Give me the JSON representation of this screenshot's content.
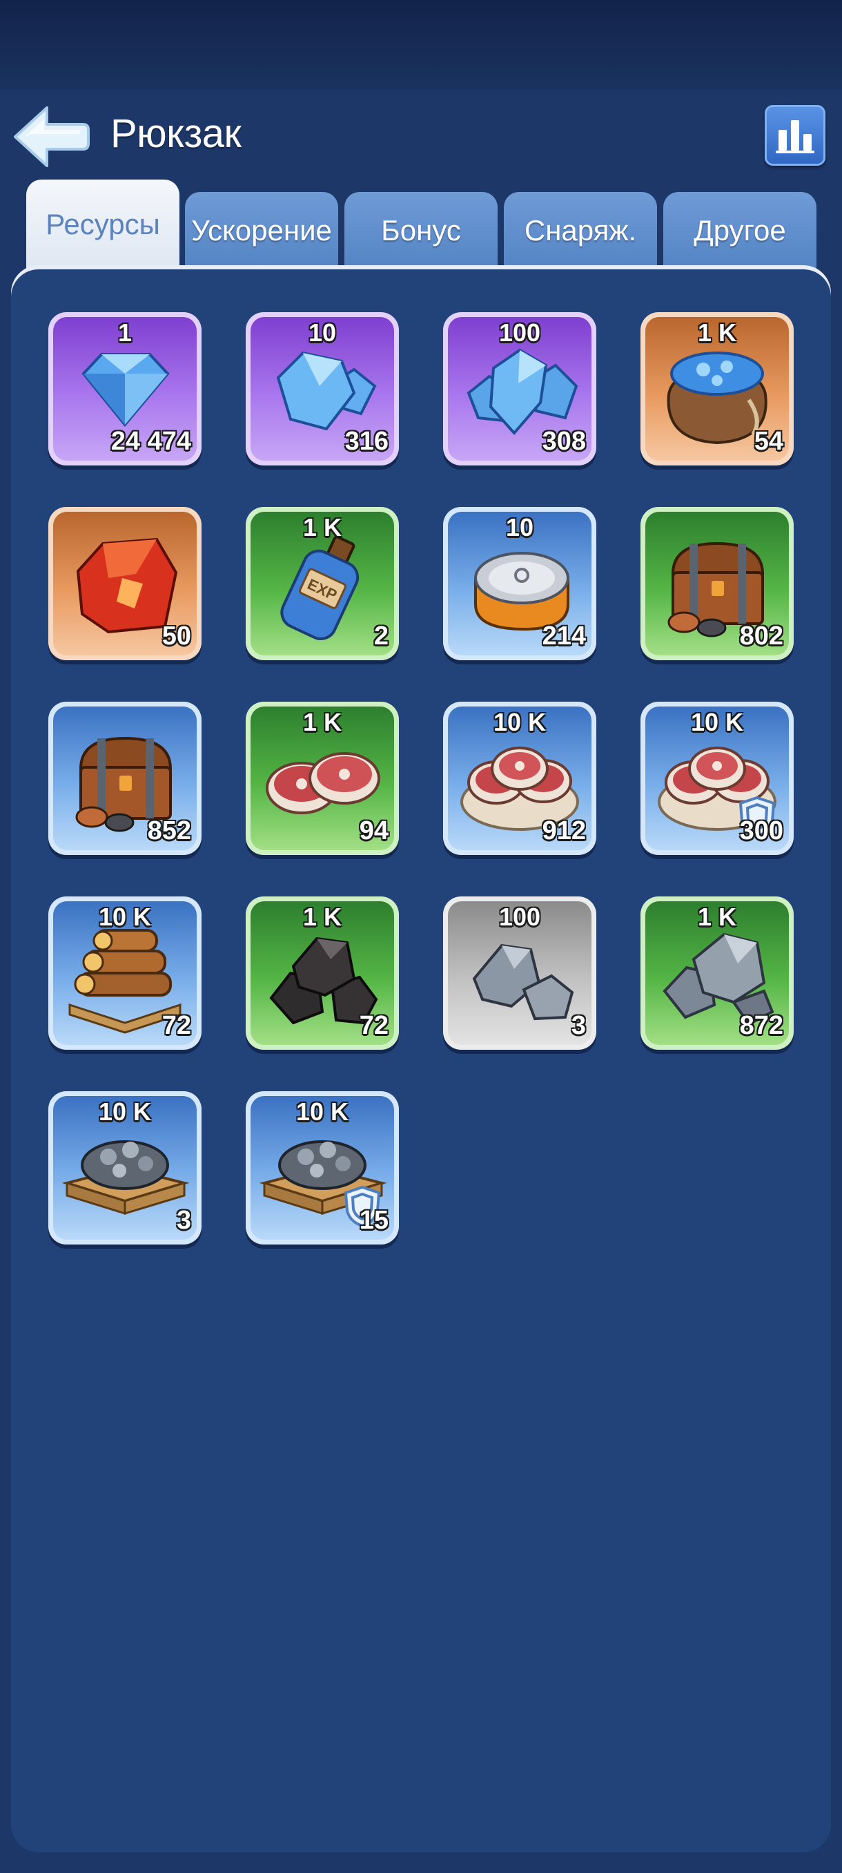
{
  "header": {
    "title": "Рюкзак"
  },
  "tabs": [
    {
      "label": "Ресурсы",
      "active": true
    },
    {
      "label": "Ускорение",
      "active": false
    },
    {
      "label": "Бонус",
      "active": false
    },
    {
      "label": "Снаряж.",
      "active": false
    },
    {
      "label": "Другое",
      "active": false
    }
  ],
  "items": [
    {
      "amount": "1",
      "count": "24 474",
      "rarity": "purple",
      "icon": "gem-icon"
    },
    {
      "amount": "10",
      "count": "316",
      "rarity": "purple",
      "icon": "gems-icon"
    },
    {
      "amount": "100",
      "count": "308",
      "rarity": "purple",
      "icon": "gem-pile-icon"
    },
    {
      "amount": "1 K",
      "count": "54",
      "rarity": "orange",
      "icon": "gem-sack-icon"
    },
    {
      "amount": "",
      "count": "50",
      "rarity": "orange",
      "icon": "red-crystal-icon"
    },
    {
      "amount": "1 K",
      "count": "2",
      "rarity": "green",
      "icon": "exp-potion-icon"
    },
    {
      "amount": "10",
      "count": "214",
      "rarity": "blue",
      "icon": "canned-food-icon"
    },
    {
      "amount": "",
      "count": "802",
      "rarity": "green",
      "icon": "resource-chest-icon"
    },
    {
      "amount": "",
      "count": "852",
      "rarity": "blue",
      "icon": "resource-chest-icon"
    },
    {
      "amount": "1 K",
      "count": "94",
      "rarity": "green",
      "icon": "meat-icon"
    },
    {
      "amount": "10 K",
      "count": "912",
      "rarity": "blue",
      "icon": "meat-plate-icon"
    },
    {
      "amount": "10 K",
      "count": "300",
      "rarity": "blue",
      "icon": "meat-plate-icon",
      "protected": true
    },
    {
      "amount": "10 K",
      "count": "72",
      "rarity": "blue",
      "icon": "wood-logs-icon"
    },
    {
      "amount": "1 K",
      "count": "72",
      "rarity": "green",
      "icon": "coal-icon"
    },
    {
      "amount": "100",
      "count": "3",
      "rarity": "gray",
      "icon": "stone-icon"
    },
    {
      "amount": "1 K",
      "count": "872",
      "rarity": "green",
      "icon": "stone-icon"
    },
    {
      "amount": "10 K",
      "count": "3",
      "rarity": "blue",
      "icon": "iron-ore-pallet-icon"
    },
    {
      "amount": "10 K",
      "count": "15",
      "rarity": "blue",
      "icon": "iron-ore-pallet-icon",
      "protected": true
    }
  ],
  "colors": {
    "background": "#1d3768",
    "panel": "#22427a",
    "tab_inactive": "#5f8fcf",
    "tab_active": "#eef3f9",
    "tab_active_text": "#5b83bd"
  }
}
